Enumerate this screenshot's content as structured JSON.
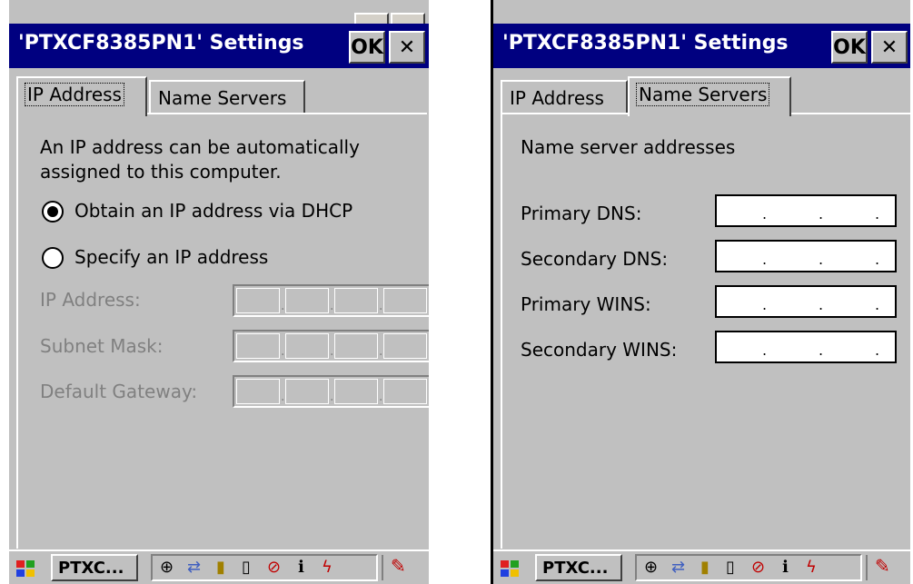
{
  "left_dialog": {
    "title": "'PTXCF8385PN1' Settings",
    "ok_label": "OK",
    "close_label": "✕",
    "tabs": [
      "IP Address",
      "Name Servers"
    ],
    "active_tab": "IP Address",
    "description_line1": "An IP address can be automatically",
    "description_line2": "assigned to this computer.",
    "radio_dhcp": {
      "label": "Obtain an IP address via DHCP",
      "selected": true
    },
    "radio_static": {
      "label": "Specify an IP address",
      "selected": false
    },
    "fields": [
      {
        "label": "IP Address:",
        "value": ". . ."
      },
      {
        "label": "Subnet Mask:",
        "value": ". . ."
      },
      {
        "label": "Default Gateway:",
        "value": ". . ."
      }
    ]
  },
  "right_dialog": {
    "title": "'PTXCF8385PN1' Settings",
    "ok_label": "OK",
    "close_label": "✕",
    "tabs": [
      "IP Address",
      "Name Servers"
    ],
    "active_tab": "Name Servers",
    "heading": "Name server addresses",
    "fields": [
      {
        "label": "Primary DNS:",
        "value": ". . ."
      },
      {
        "label": "Secondary DNS:",
        "value": ". . ."
      },
      {
        "label": "Primary WINS:",
        "value": ". . ."
      },
      {
        "label": "Secondary WINS:",
        "value": ". . ."
      }
    ]
  },
  "taskbar": {
    "task_label": "PTXC...",
    "tray_icons": [
      "network-icon",
      "connection-icon",
      "battery-icon",
      "device-icon",
      "no-signal-icon",
      "info-icon",
      "power-icon"
    ],
    "pen_icon": "pen-icon"
  },
  "colors": {
    "titlebar": "#000080",
    "window": "#c0c0c0",
    "disabled_text": "#808080"
  }
}
